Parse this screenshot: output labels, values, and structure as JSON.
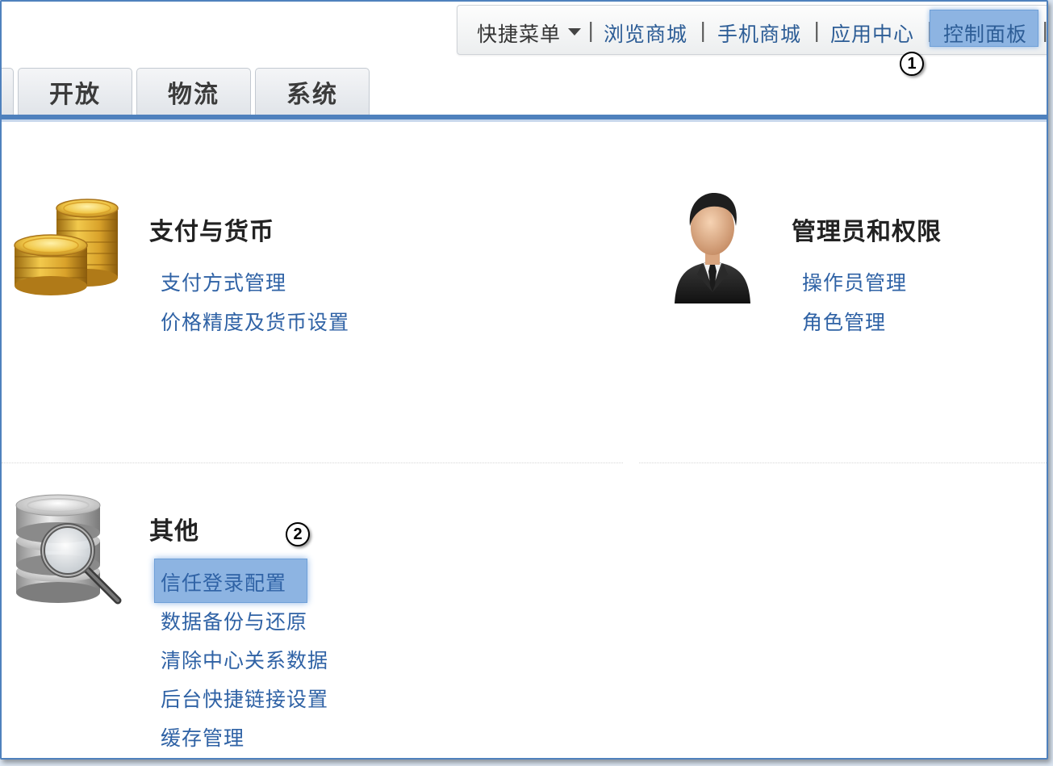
{
  "top_nav": {
    "quick_menu": "快捷菜单",
    "items": [
      "浏览商城",
      "手机商城",
      "应用中心",
      "控制面板"
    ],
    "separator": "|"
  },
  "tabs": [
    "开放",
    "物流",
    "系统"
  ],
  "callouts": [
    "1",
    "2"
  ],
  "sections": {
    "payment": {
      "title": "支付与货币",
      "links": [
        "支付方式管理",
        "价格精度及货币设置"
      ]
    },
    "admin": {
      "title": "管理员和权限",
      "links": [
        "操作员管理",
        "角色管理"
      ]
    },
    "other": {
      "title": "其他",
      "links": [
        "信任登录配置",
        "数据备份与还原",
        "清除中心关系数据",
        "后台快捷链接设置",
        "缓存管理"
      ]
    }
  },
  "icons": {
    "payment": "gold-coins-icon",
    "admin": "admin-user-icon",
    "other": "database-search-icon"
  },
  "colors": {
    "accent": "#4f81bd",
    "highlight": "#8db4e2",
    "link": "#2f62a5"
  }
}
